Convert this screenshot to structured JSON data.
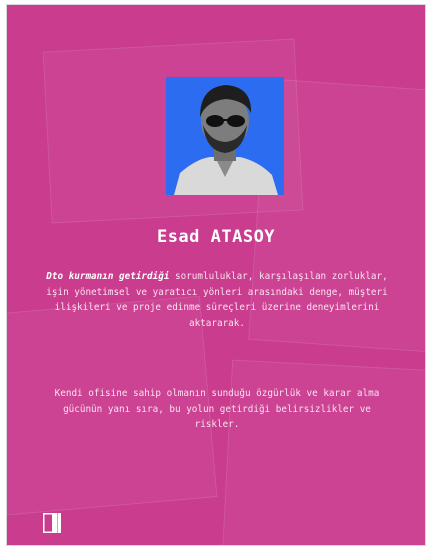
{
  "profile": {
    "name": "Esad ATASOY",
    "photo_icon": "portrait-photo",
    "photo_bg": "#2c6cf0"
  },
  "bio": {
    "p1_bold": "Dto kurmanın getirdiği",
    "p1_rest": " sorumluluklar, karşılaşılan zorluklar, işin yönetimsel ve yaratıcı yönleri arasındaki denge, müşteri ilişkileri ve proje edinme süreçleri üzerine deneyimlerini aktararak.",
    "p2": "Kendi ofisine sahip olmanın sunduğu özgürlük ve karar alma gücünün yanı sıra, bu yolun getirdiği belirsizlikler ve riskler."
  },
  "brand": {
    "logo_icon": "brand-logo-icon"
  },
  "colors": {
    "background": "#c93c8e",
    "text": "#ffffff"
  }
}
